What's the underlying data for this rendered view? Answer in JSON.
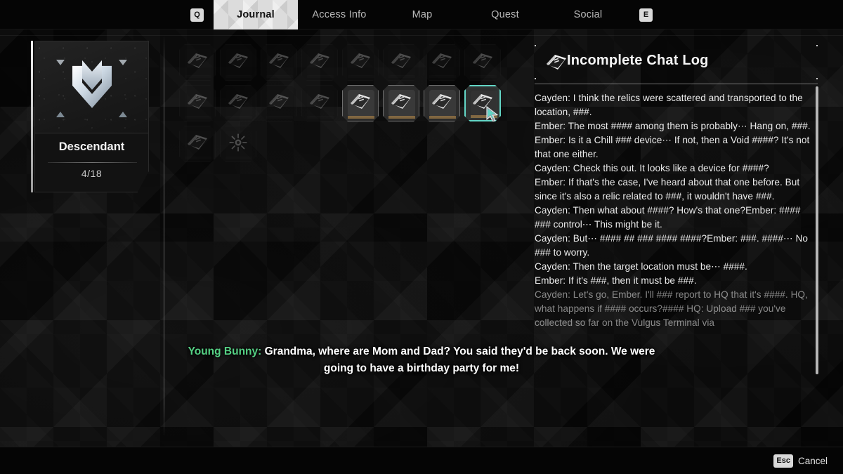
{
  "topbar": {
    "left_key": "Q",
    "right_key": "E",
    "tabs": [
      {
        "label": "Journal",
        "active": true
      },
      {
        "label": "Access Info",
        "active": false
      },
      {
        "label": "Map",
        "active": false
      },
      {
        "label": "Quest",
        "active": false
      },
      {
        "label": "Social",
        "active": false
      }
    ]
  },
  "category_card": {
    "name": "Descendant",
    "count": "4/18",
    "emblem": "chevron-emblem"
  },
  "grid": {
    "rows": [
      [
        {
          "state": "dim",
          "icon": "book-icon"
        },
        {
          "state": "dim",
          "icon": "book-icon"
        },
        {
          "state": "dim",
          "icon": "book-icon"
        },
        {
          "state": "dim",
          "icon": "book-icon"
        },
        {
          "state": "dim",
          "icon": "book-icon"
        },
        {
          "state": "dim",
          "icon": "book-icon"
        },
        {
          "state": "dim",
          "icon": "book-icon"
        },
        {
          "state": "dim",
          "icon": "book-icon"
        }
      ],
      [
        {
          "state": "dim",
          "icon": "book-icon"
        },
        {
          "state": "dim",
          "icon": "book-icon"
        },
        {
          "state": "dim",
          "icon": "book-icon"
        },
        {
          "state": "dim",
          "icon": "book-icon"
        },
        {
          "state": "lit",
          "icon": "book-icon"
        },
        {
          "state": "lit",
          "icon": "book-icon"
        },
        {
          "state": "lit",
          "icon": "book-icon"
        },
        {
          "state": "selected",
          "icon": "book-icon"
        }
      ],
      [
        {
          "state": "dim",
          "icon": "book-icon"
        },
        {
          "state": "dim",
          "icon": "sun-icon"
        }
      ]
    ]
  },
  "detail": {
    "title": "Incomplete Chat Log",
    "title_icon": "book-icon",
    "log_lines": [
      "Cayden: I think the relics were scattered and transported to the location, ###.",
      "Ember: The most #### among them is probably⋯ Hang on, ###.",
      "Ember: Is it a Chill ### device⋯ If not, then a Void ####? It's not that one either.",
      "Cayden: Check this out. It looks like a device for ####?",
      "Ember: If that's the case, I've heard about that one before. But since it's also a relic related to ###, it wouldn't have ###.",
      "Cayden: Then what about ####? How's that one?Ember: #### ### control⋯ This might be it.",
      "Cayden: But⋯ #### ## ### #### ####?Ember: ###. ####⋯ No ### to worry.",
      "Cayden: Then the target location must be⋯ ####.",
      "Ember: If it's ###, then it must be ###.",
      "Cayden: Let's go, Ember. I'll ### report to HQ that it's ####. HQ, what happens if #### occurs?#### HQ: Upload ### you've collected so far on the Vulgus Terminal via"
    ]
  },
  "subtitle": {
    "speaker": "Young Bunny:",
    "text": " Grandma, where are Mom and Dad? You said they'd be back soon. We were going to have a birthday party for me!",
    "speaker_color": "#55d184"
  },
  "bottombar": {
    "key": "Esc",
    "label": "Cancel"
  },
  "colors": {
    "selection": "#63d6c6",
    "panel_bg": "#0b0b0b"
  }
}
